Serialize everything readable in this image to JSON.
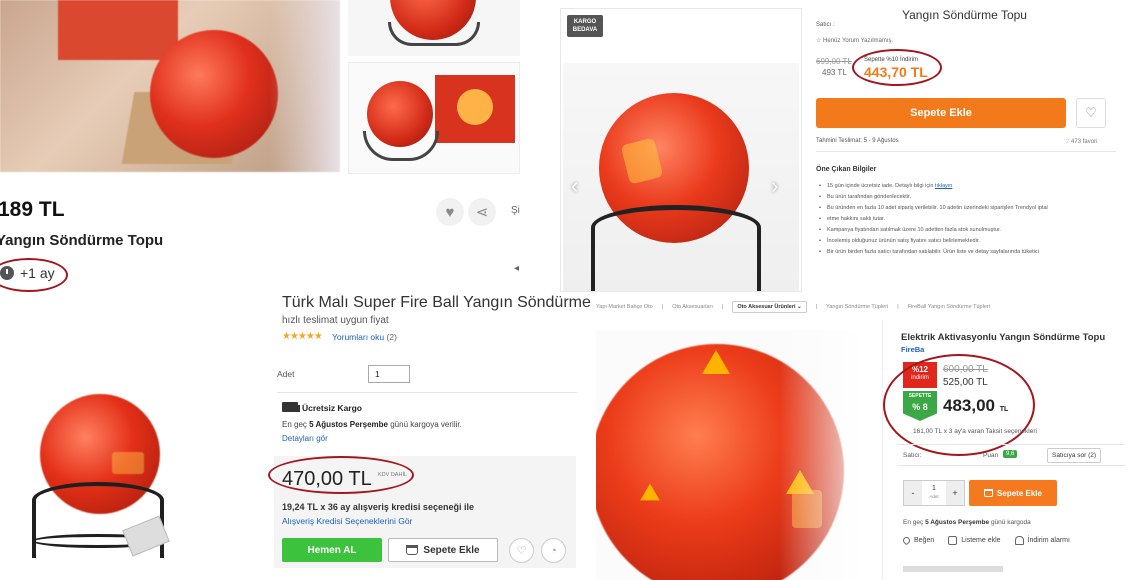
{
  "panel_a": {
    "price": "189 TL",
    "title": "Yangın Söndürme Topu",
    "time_badge": "+1 ay",
    "more_label": "Şi",
    "arrow_glyph": "◂",
    "icons": [
      "heart-icon",
      "share-icon",
      "clock-icon"
    ]
  },
  "panel_b": {
    "badge": "KARGO BEDAVA",
    "title": "Yangın Söndürme Topu",
    "seller_label": "Satıcı :",
    "reviews": "Henüz Yorum Yazılmamış.",
    "old_price": "699,00 TL",
    "current_price": "493 TL",
    "cart_discount_label": "Sepette %10 İndirim",
    "final_price": "443,70 TL",
    "add_to_cart": "Sepete Ekle",
    "shipping": "Tahmini Teslimat: 5 - 9 Ağustos",
    "favorites": "473 favori",
    "features_title": "Öne Çıkan Bilgiler",
    "features": [
      "15 gün içinde ücretsiz iade. Detaylı bilgi için",
      "Bu ürün tarafından gönderilecektir.",
      "Bu üründen en fazla 10 adet sipariş verilebilir. 10 adetin üzerindeki siparişleri Trendyol iptal",
      "etme hakkını saklı tutar.",
      "Kampanya fiyatından satılmak üzere 10 adetten fazla stok sunulmuştur.",
      "İncelemiş olduğunuz ürünün satış fiyatını satıcı belirlemektedir.",
      "Bir ürün birden fazla satıcı tarafından satılabilir. Ürün liste ve detay sayfalarında tüketici"
    ],
    "feature_link": "tıklayın",
    "nav_prev": "‹",
    "nav_next": "›"
  },
  "panel_c": {
    "title": "Türk Malı Super Fire Ball Yangın Söndürme Topu",
    "subtitle": "hızlı teslimat uygun fiyat",
    "stars": "★★★★★",
    "reviews_link": "Yorumları oku",
    "reviews_count": "(2)",
    "quantity_label": "Adet",
    "quantity_value": "1",
    "free_shipping": "Ücretsiz Kargo",
    "delivery_prefix": "En geç",
    "delivery_date": "5 Ağustos Perşembe",
    "delivery_suffix": "günü kargoya verilir.",
    "details_link": "Detayları gör",
    "price": "470,00 TL",
    "kdv": "KDV DAHİL",
    "installment": "19,24 TL x 36 ay alışveriş kredisi seçeneği ile",
    "installment_link": "Alışveriş Kredisi Seçeneklerini Gör",
    "buy_now": "Hemen AL",
    "add_to_cart": "Sepete Ekle"
  },
  "panel_d": {
    "breadcrumb": [
      "Yapı Market Bahçe Oto",
      "Oto Aksesuarları",
      "Oto Aksesuar Ürünleri",
      "Yangın Söndürme Tüpleri",
      "FireBall Yangın Söndürme Tüpleri"
    ],
    "title": "Elektrik Aktivasyonlu Yangın Söndürme Topu",
    "brand": "FireBa",
    "discount_pct": "%12",
    "discount_label": "indirim",
    "old_price": "600,00 TL",
    "current_price": "525,00 TL",
    "cart_badge_label": "SEPETTE",
    "cart_badge_pct": "% 8",
    "final_price": "483,00",
    "final_currency": "TL",
    "installment": "161,00 TL x 3 ay'a varan Taksit seçenekleri",
    "seller_label": "Satıcı:",
    "points_label": "Puan",
    "score": "9,6",
    "ask_seller": "Satıcıya sor (2)",
    "qty_minus": "-",
    "qty_value": "1",
    "qty_unit": "Adet",
    "qty_plus": "+",
    "add_to_cart": "Sepete Ekle",
    "latest_prefix": "En geç",
    "latest_date": "5 Ağustos Perşembe",
    "latest_suffix": "günü kargoda",
    "actions": [
      "Beğen",
      "Listeme ekle",
      "İndirim alarmı"
    ]
  },
  "colors": {
    "highlight_oval": "#a3161f",
    "orange_cta": "#f27a1a",
    "green_cta": "#3cc23c",
    "link_blue": "#1d60c0",
    "discount_red": "#e1261c",
    "cart_green": "#39a845"
  }
}
